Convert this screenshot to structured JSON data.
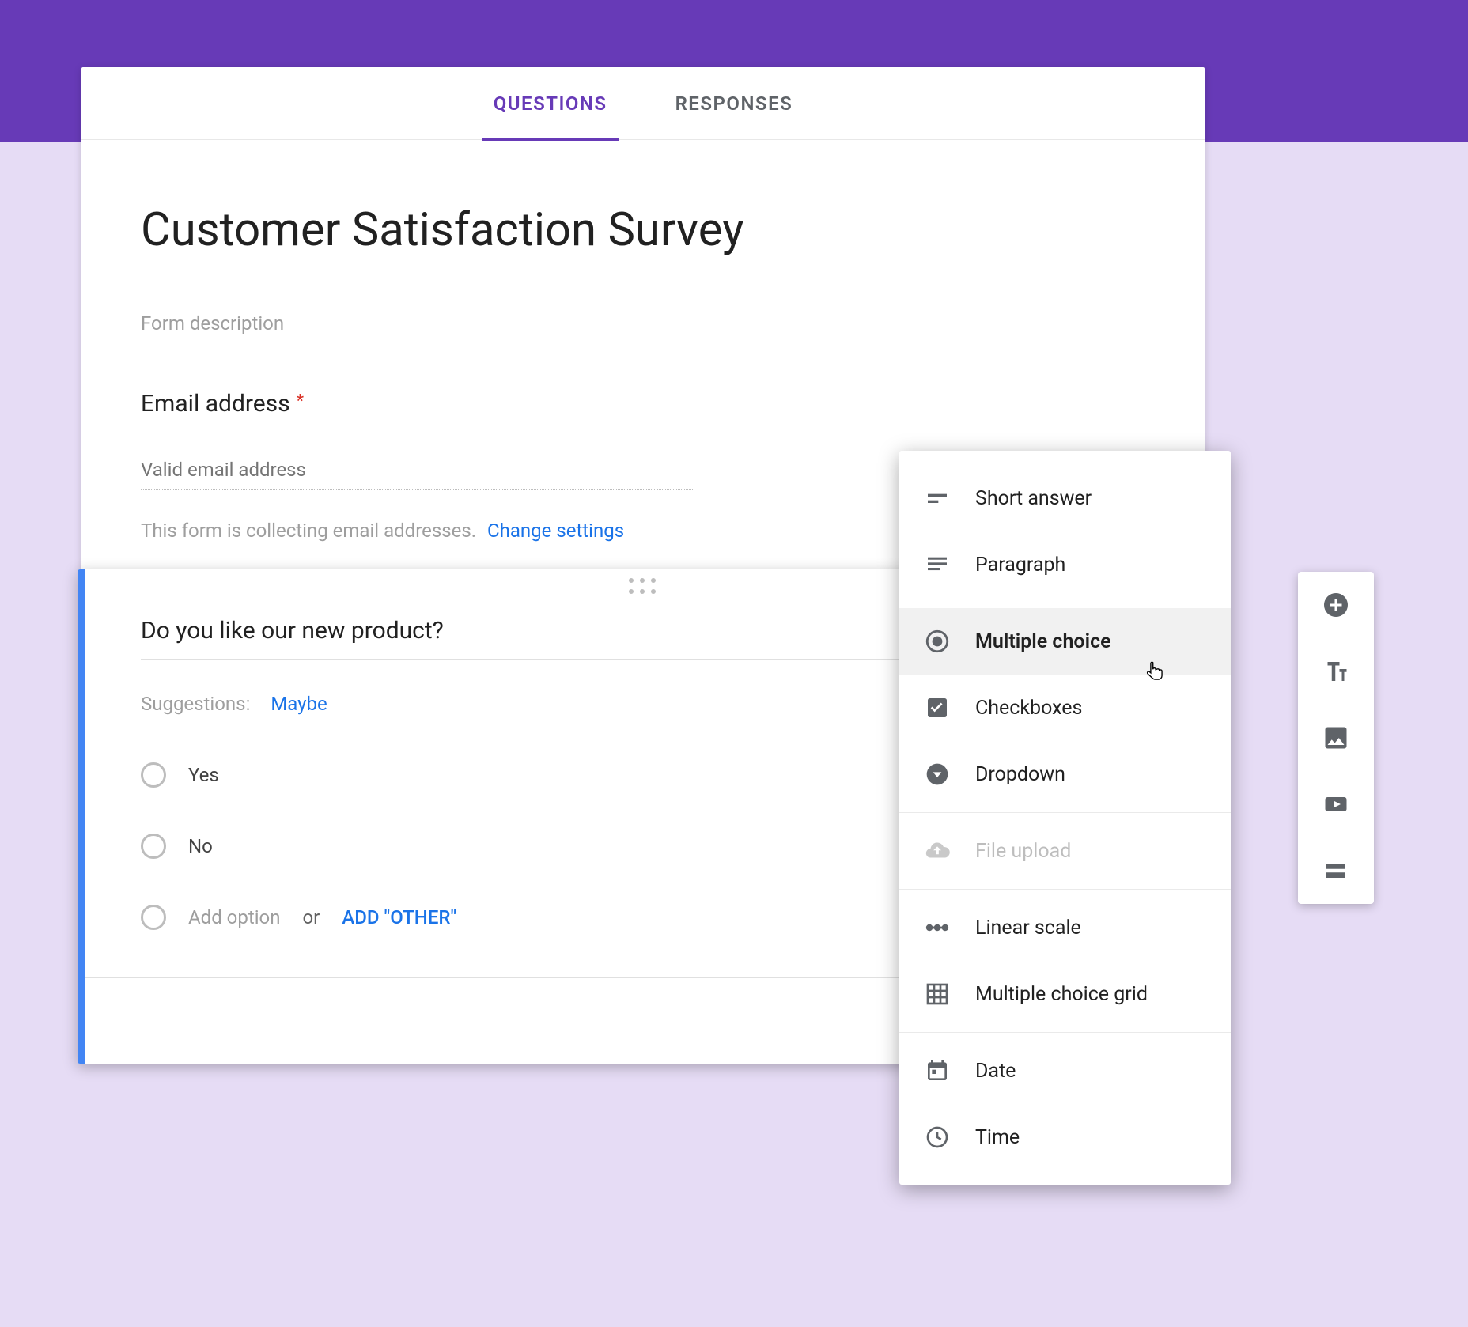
{
  "tabs": {
    "questions": "QUESTIONS",
    "responses": "RESPONSES"
  },
  "form": {
    "title": "Customer Satisfaction Survey",
    "description": "Form description",
    "email_label": "Email address",
    "required_mark": "*",
    "email_placeholder": "Valid email address",
    "collecting_note": "This form is collecting email addresses.",
    "change_settings": "Change settings"
  },
  "question": {
    "title": "Do you like our new product?",
    "suggestions_label": "Suggestions:",
    "suggestion1": "Maybe",
    "options": [
      "Yes",
      "No"
    ],
    "add_option_text": "Add option",
    "or_text": "or",
    "add_other_text": "ADD \"OTHER\""
  },
  "dropdown": {
    "short_answer": "Short answer",
    "paragraph": "Paragraph",
    "multiple_choice": "Multiple choice",
    "checkboxes": "Checkboxes",
    "dropdown": "Dropdown",
    "file_upload": "File upload",
    "linear_scale": "Linear scale",
    "mcq_grid": "Multiple choice grid",
    "date": "Date",
    "time": "Time"
  }
}
